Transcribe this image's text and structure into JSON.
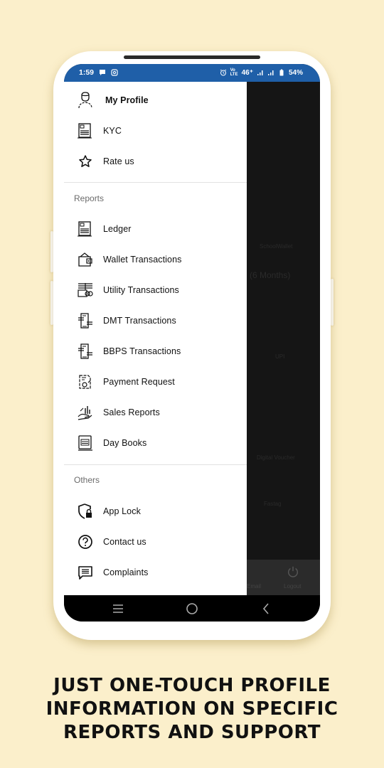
{
  "status_bar": {
    "time": "1:59",
    "network": "46⁺",
    "volte": "VoLTE",
    "battery": "54%"
  },
  "drawer": {
    "top_items": [
      {
        "label": "My Profile",
        "icon": "user-profile-icon"
      },
      {
        "label": "KYC",
        "icon": "document-icon"
      },
      {
        "label": "Rate us",
        "icon": "star-icon"
      }
    ],
    "reports_section": "Reports",
    "report_items": [
      {
        "label": "Ledger",
        "icon": "ledger-icon"
      },
      {
        "label": "Wallet Transactions",
        "icon": "wallet-icon"
      },
      {
        "label": "Utility Transactions",
        "icon": "utility-icon"
      },
      {
        "label": "DMT Transactions",
        "icon": "dmt-icon"
      },
      {
        "label": "BBPS Transactions",
        "icon": "bbps-icon"
      },
      {
        "label": "Payment Request",
        "icon": "payment-request-icon"
      },
      {
        "label": "Sales Reports",
        "icon": "sales-report-icon"
      },
      {
        "label": "Day Books",
        "icon": "day-book-icon"
      }
    ],
    "others_section": "Others",
    "other_items": [
      {
        "label": "App Lock",
        "icon": "shield-lock-icon"
      },
      {
        "label": "Contact us",
        "icon": "help-circle-icon"
      },
      {
        "label": "Complaints",
        "icon": "chat-icon"
      }
    ]
  },
  "background_app": {
    "brand": "SchoolWallet",
    "months_text": "(6 Months)",
    "upi_label": "UPI",
    "digital_voucher_label": "Digital Voucher",
    "fastag_label": "Fastag",
    "bottom_left_label": "Email",
    "logout_label": "Logout"
  },
  "caption": {
    "line1": "JUST ONE-TOUCH PROFILE",
    "line2": "INFORMATION ON SPECIFIC",
    "line3": "REPORTS AND SUPPORT"
  },
  "colors": {
    "background": "#fbefcb",
    "status_bar": "#1f5fa8",
    "drawer": "#ffffff",
    "scrim": "#141414"
  }
}
